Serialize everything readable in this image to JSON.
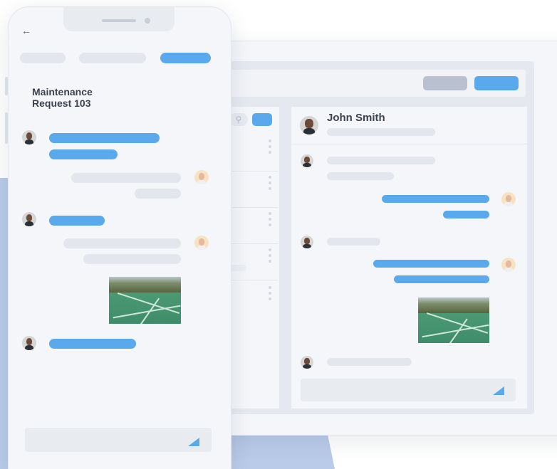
{
  "phone": {
    "back_icon": "arrow-left-icon",
    "back_glyph": "←",
    "title_line1": "Maintenance",
    "title_line2": "Request 103",
    "send_icon": "send-icon"
  },
  "tablet": {
    "contact_name": "John Smith",
    "search_icon": "search-icon",
    "search_glyph": "⚲",
    "send_icon": "send-icon"
  },
  "colors": {
    "accent": "#5aa9ec",
    "placeholder_bar": "#e3e6ec",
    "muted_button": "#b9c0d0",
    "backdrop": "#b9cbe8"
  }
}
